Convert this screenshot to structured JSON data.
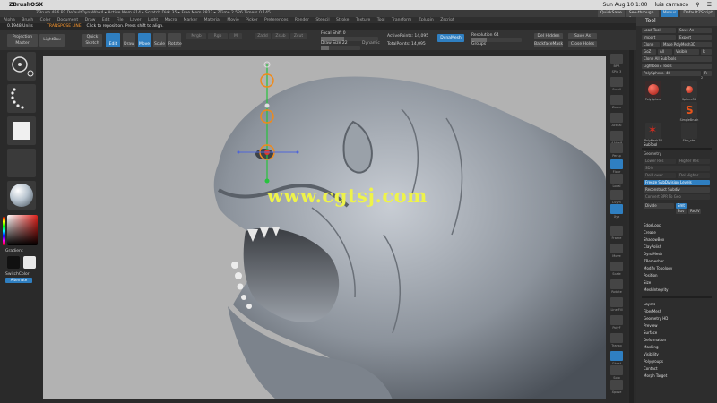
{
  "mac": {
    "app_name": "ZBrushOSX",
    "datetime": "Sun Aug 10  1:00",
    "user": "luis carrasco"
  },
  "title": {
    "text": "ZBrush 4R6 P2     DefaultDynaWax4     ▸ Active Mem 614  ▸ Scratch Disk 35  ▸ Free Mem 2823  ▸ ZTime 2.526  Timers 0.145",
    "quicksave": "QuickSave",
    "see_through": "See-through  0",
    "menus_label": "Menus",
    "script": "DefaultZScript"
  },
  "menus": [
    "Alpha",
    "Brush",
    "Color",
    "Document",
    "Draw",
    "Edit",
    "File",
    "Layer",
    "Light",
    "Macro",
    "Marker",
    "Material",
    "Movie",
    "Picker",
    "Preferences",
    "Render",
    "Stencil",
    "Stroke",
    "Texture",
    "Tool",
    "Transform",
    "Zplugin",
    "Zscript"
  ],
  "status": {
    "value": "0.1948 Units",
    "mode": "TRANSPOSE LINE:",
    "hint": "Click to reposition. Press shift to align."
  },
  "toolbar": {
    "projection_master": "Projection Master",
    "lightbox": "LightBox",
    "quick_sketch": "Quick Sketch",
    "edit": "Edit",
    "draw": "Draw",
    "move": "Move",
    "scale": "Scale",
    "rotate": "Rotate",
    "mrgb": "Mrgb",
    "rgb": "Rgb",
    "m": "M",
    "zadd": "Zadd",
    "zsub": "Zsub",
    "zcut": "Zcut",
    "focal_shift": "Focal Shift 0",
    "draw_size": "Draw Size 22",
    "dynamic": "Dynamic",
    "active_points": "ActivePoints: 14,095",
    "total_points": "TotalPoints: 14,095",
    "dynamesh": "DynaMesh",
    "resolution": "Resolution 64",
    "groups": "Groups",
    "del_hidden": "Del Hidden",
    "backface_mask": "BackfaceMask",
    "save_as": "Save As",
    "close_holes": "Close Holes"
  },
  "left": {
    "gradient": "Gradient",
    "switch_color": "SwitchColor",
    "alternate": "Alternate"
  },
  "right_shelf": [
    "BPR",
    "SPix 3",
    "Scroll",
    "Zoom",
    "Actual",
    "AAHalf",
    "Persp",
    "Floor",
    "Local",
    "LSym",
    "Xyz",
    "Frame",
    "Move",
    "Scale",
    "Rotate",
    "Line Fill",
    "PolyF",
    "Transp",
    "Ghost",
    "Solo",
    "Xpose"
  ],
  "tool": {
    "header": "Tool",
    "load_tool": "Load Tool",
    "save_as": "Save As",
    "import": "Import",
    "export": "Export",
    "clone": "Clone",
    "make_polymesh": "Make PolyMesh3D",
    "goz": "GoZ",
    "all": "All",
    "visible": "Visible",
    "r": "R",
    "clone_all": "Clone All SubTools",
    "lightbox_tools": "Lightbox ▸ Tools",
    "polysphere": "PolySphere. 48",
    "r2": "R",
    "thumbs": [
      "PolySphere",
      "Sphere3D",
      "Cylinder3D",
      "SimpleBrush",
      "PolyMesh3D",
      "Star_stm"
    ],
    "count": "2",
    "subtool": "SubTool",
    "geometry": "Geometry",
    "lower_res": "Lower Res",
    "higher_res": "Higher Res",
    "sdiv": "SDiv",
    "del_lower": "Del Lower",
    "del_higher": "Del Higher",
    "freeze": "Freeze SubDivision Levels",
    "reconstruct": "Reconstruct Subdiv",
    "convert_bpr": "Convert BPR To Geo",
    "divide": "Divide",
    "smt": "Smt",
    "suv": "Suv",
    "reuv": "ReUV",
    "sections": [
      "EdgeLoop",
      "Crease",
      "ShadowBox",
      "ClayPolish",
      "DynaMesh",
      "ZRemesher",
      "Modify Topology",
      "Position",
      "Size",
      "MeshIntegrity"
    ],
    "sections2": [
      "Layers",
      "FiberMesh",
      "Geometry HD",
      "Preview",
      "Surface",
      "Deformation",
      "Masking",
      "Visibility",
      "Polygroups",
      "Contact",
      "Morph Target"
    ]
  },
  "watermark": "www.cgtsj.com",
  "colors": {
    "accent": "#2f7fc1",
    "orange": "#ff9a2e",
    "canvas": "#b2b2b2",
    "watermark": "#eef34a"
  }
}
